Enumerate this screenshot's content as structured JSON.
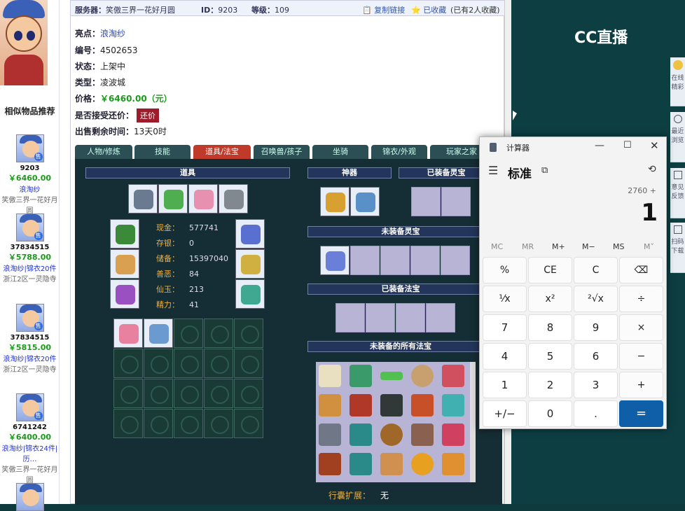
{
  "header": {
    "server_label": "服务器：",
    "server": "笑傲三界一花好月圆",
    "id_label": "ID：",
    "id": "9203",
    "level_label": "等级：",
    "level": "109",
    "copy_link": "复制链接",
    "favorited": "已收藏",
    "fav_count": "(已有2人收藏)"
  },
  "item": {
    "highlight_label": "亮点：",
    "highlight": "浪淘纱",
    "number_label": "编号：",
    "number": "4502653",
    "status_label": "状态：",
    "status": "上架中",
    "type_label": "类型：",
    "type": "凌波城",
    "price_label": "价格：",
    "price": "￥6460.00（元）",
    "haggle_label": "是否接受还价：",
    "haggle_button": "还价",
    "remaining_label": "出售剩余时间：",
    "remaining": "13天0时"
  },
  "similar": {
    "title": "相似物品推荐",
    "items": [
      {
        "id": "9203",
        "price": "￥6460.00",
        "name": "浪淘纱",
        "server": "笑傲三界一花好月圆"
      },
      {
        "id": "37834515",
        "price": "￥5788.00",
        "name": "浪淘纱|锦衣20件",
        "server": "浙江2区一灵隐寺"
      },
      {
        "id": "37834515",
        "price": "￥5815.00",
        "name": "浪淘纱|锦衣20件",
        "server": "浙江2区一灵隐寺"
      },
      {
        "id": "6741242",
        "price": "￥6400.00",
        "name": "浪淘纱|锦衣24件|历…",
        "server": "笑傲三界一花好月圆"
      }
    ]
  },
  "tabs": [
    "人物/修炼",
    "技能",
    "道具/法宝",
    "召唤兽/孩子",
    "坐骑",
    "锦衣/外观",
    "玩家之家"
  ],
  "sections": {
    "items": "道具",
    "artifact": "神器",
    "equipped_spirit": "已装备灵宝",
    "unequipped_spirit": "未装备灵宝",
    "equipped_fabao": "已装备法宝",
    "all_fabao": "未装备的所有法宝"
  },
  "stats": [
    {
      "k": "现金：",
      "v": "577741"
    },
    {
      "k": "存银：",
      "v": "0"
    },
    {
      "k": "储备：",
      "v": "15397040"
    },
    {
      "k": "善恶：",
      "v": "84"
    },
    {
      "k": "仙玉：",
      "v": "213"
    },
    {
      "k": "精力：",
      "v": "41"
    }
  ],
  "bag_ext_label": "行囊扩展：",
  "bag_ext_value": "无",
  "calculator": {
    "title": "计算器",
    "mode": "标准",
    "expression": "2760 +",
    "display": "1",
    "memory": [
      "MC",
      "MR",
      "M+",
      "M−",
      "MS",
      "M˅"
    ],
    "buttons": [
      [
        "%",
        "CE",
        "C",
        "⌫"
      ],
      [
        "¹⁄x",
        "x²",
        "²√x",
        "÷"
      ],
      [
        "7",
        "8",
        "9",
        "×"
      ],
      [
        "4",
        "5",
        "6",
        "−"
      ],
      [
        "1",
        "2",
        "3",
        "+"
      ],
      [
        "+/−",
        "0",
        ".",
        "="
      ]
    ]
  },
  "cc": {
    "logo": "CC直播"
  },
  "side": [
    "在线精彩",
    "最近浏览",
    "意见反馈",
    "扫码下载"
  ],
  "colors": {
    "accent": "#0e5fa8",
    "active_tab": "#c03a2a",
    "price_green": "#1b9a1b"
  }
}
